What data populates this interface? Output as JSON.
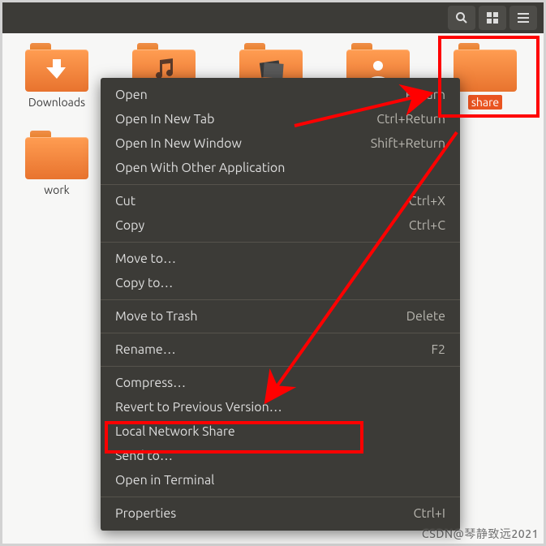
{
  "folders": {
    "downloads": {
      "label": "Downloads"
    },
    "music": {
      "label": "Music"
    },
    "pictures": {
      "label": "Pictures"
    },
    "public": {
      "label": "Public"
    },
    "share": {
      "label": "share"
    },
    "work": {
      "label": "work"
    }
  },
  "menu": {
    "open": {
      "label": "Open",
      "accel": "Return"
    },
    "open_tab": {
      "label": "Open In New Tab",
      "accel": "Ctrl+Return"
    },
    "open_win": {
      "label": "Open In New Window",
      "accel": "Shift+Return"
    },
    "open_with": {
      "label": "Open With Other Application",
      "accel": ""
    },
    "cut": {
      "label": "Cut",
      "accel": "Ctrl+X"
    },
    "copy": {
      "label": "Copy",
      "accel": "Ctrl+C"
    },
    "move_to": {
      "label": "Move to…",
      "accel": ""
    },
    "copy_to": {
      "label": "Copy to…",
      "accel": ""
    },
    "trash": {
      "label": "Move to Trash",
      "accel": "Delete"
    },
    "rename": {
      "label": "Rename…",
      "accel": "F2"
    },
    "compress": {
      "label": "Compress…",
      "accel": ""
    },
    "revert": {
      "label": "Revert to Previous Version…",
      "accel": ""
    },
    "network_share": {
      "label": "Local Network Share",
      "accel": ""
    },
    "send_to": {
      "label": "Send to…",
      "accel": ""
    },
    "terminal": {
      "label": "Open in Terminal",
      "accel": ""
    },
    "properties": {
      "label": "Properties",
      "accel": "Ctrl+I"
    }
  },
  "watermark": "CSDN@琴静致远2021"
}
